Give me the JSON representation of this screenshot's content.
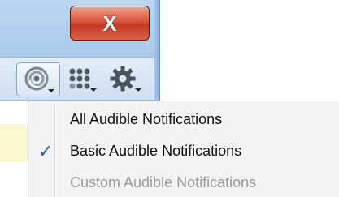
{
  "window": {
    "close_glyph": "X",
    "toolbar": {
      "buttons": [
        {
          "icon": "audible-notifications-icon"
        },
        {
          "icon": "dots-grid-icon"
        },
        {
          "icon": "gear-icon"
        }
      ]
    }
  },
  "menu": {
    "items": [
      {
        "label": "All Audible Notifications",
        "checked": false,
        "enabled": true
      },
      {
        "label": "Basic Audible Notifications",
        "checked": true,
        "check_glyph": "✓",
        "enabled": true
      },
      {
        "label": "Custom Audible Notifications",
        "checked": false,
        "enabled": false
      }
    ]
  },
  "colors": {
    "check": "#1d5fb0",
    "disabled_text": "#9a9a9a",
    "close_red": "#c23a22"
  }
}
